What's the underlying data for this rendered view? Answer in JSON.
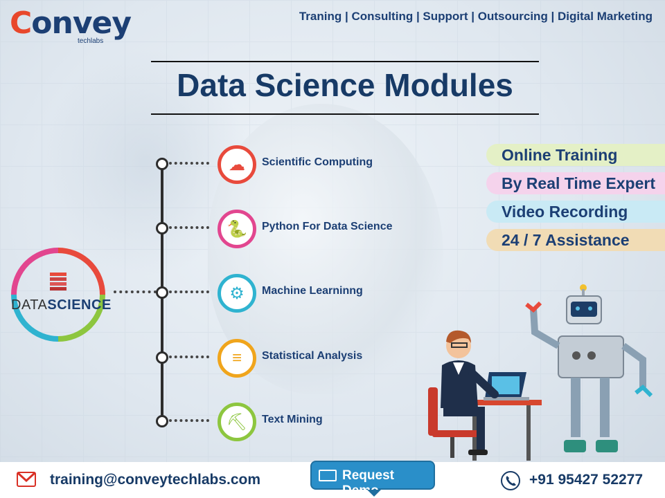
{
  "brand": {
    "logo_text": "Convey",
    "logo_sub": "techlabs"
  },
  "topnav": {
    "text": "Traning | Consulting | Support | Outsourcing | Digital Marketing"
  },
  "title": "Data Science Modules",
  "badge": {
    "data": "DATA",
    "science": "SCIENCE"
  },
  "modules": [
    {
      "label": "Scientific Computing",
      "icon": "brain-icon",
      "color": "#e84a3c"
    },
    {
      "label": "Python For Data Science",
      "icon": "python-icon",
      "color": "#e2468f"
    },
    {
      "label": "Machine Learninng",
      "icon": "ml-head-icon",
      "color": "#2fb3d0"
    },
    {
      "label": "Statistical Analysis",
      "icon": "database-chart-icon",
      "color": "#f0a51c"
    },
    {
      "label": "Text Mining",
      "icon": "mining-icon",
      "color": "#8dc63f"
    }
  ],
  "features": [
    {
      "label": "Online Training",
      "color": "#e4f0c6"
    },
    {
      "label": "By Real Time Expert",
      "color": "#f5d3ec"
    },
    {
      "label": "Video Recording",
      "color": "#c9eaf5"
    },
    {
      "label": "24 / 7 Assistance",
      "color": "#f1dcb5"
    }
  ],
  "footer": {
    "email": "training@conveytechlabs.com",
    "demo_label": "Request Demo",
    "phone": "+91 95427 52277"
  }
}
